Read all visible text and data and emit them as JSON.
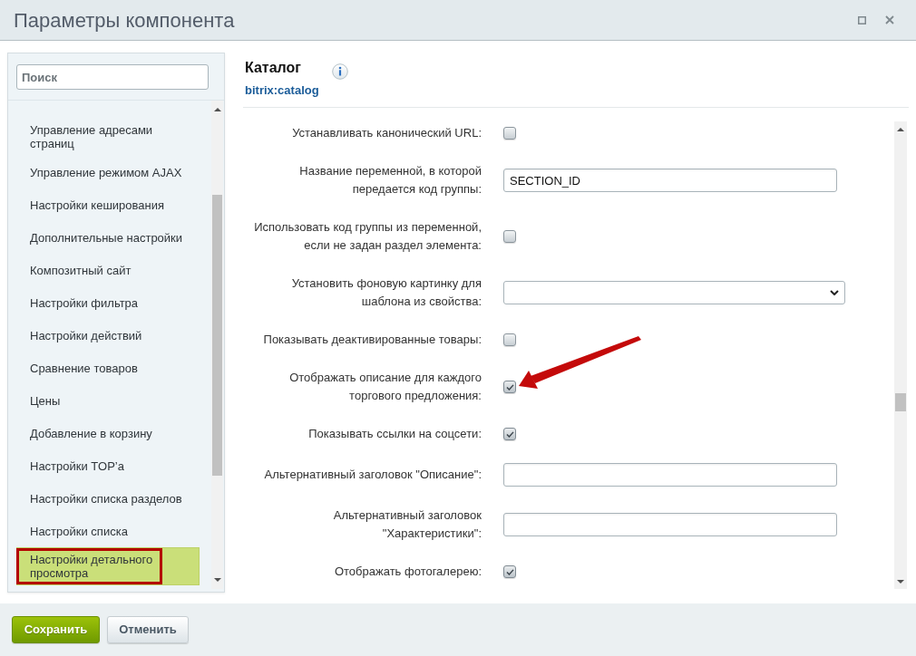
{
  "window": {
    "title": "Параметры компонента"
  },
  "sidebar": {
    "search": {
      "placeholder": "Поиск"
    },
    "items": [
      {
        "label": "Управление адресами страниц",
        "selected": false,
        "framed": false
      },
      {
        "label": "Управление режимом AJAX",
        "selected": false,
        "framed": false
      },
      {
        "label": "Настройки кеширования",
        "selected": false,
        "framed": false
      },
      {
        "label": "Дополнительные настройки",
        "selected": false,
        "framed": false
      },
      {
        "label": "Композитный сайт",
        "selected": false,
        "framed": false
      },
      {
        "label": "Настройки фильтра",
        "selected": false,
        "framed": false
      },
      {
        "label": "Настройки действий",
        "selected": false,
        "framed": false
      },
      {
        "label": "Сравнение товаров",
        "selected": false,
        "framed": false
      },
      {
        "label": "Цены",
        "selected": false,
        "framed": false
      },
      {
        "label": "Добавление в корзину",
        "selected": false,
        "framed": false
      },
      {
        "label": "Настройки TOP’а",
        "selected": false,
        "framed": false
      },
      {
        "label": "Настройки списка разделов",
        "selected": false,
        "framed": false
      },
      {
        "label": "Настройки списка",
        "selected": false,
        "framed": false
      },
      {
        "label": "Настройки детального просмотра",
        "selected": true,
        "framed": true
      }
    ]
  },
  "component": {
    "name": "Каталог",
    "code": "bitrix:catalog"
  },
  "settings": [
    {
      "kind": "checkbox",
      "label": "Устанавливать канонический URL:",
      "checked": false,
      "arrow": false
    },
    {
      "kind": "text",
      "label": "Название переменной, в которой передается код группы:",
      "value": "SECTION_ID",
      "arrow": false
    },
    {
      "kind": "checkbox",
      "label": "Использовать код группы из переменной, если не задан раздел элемента:",
      "checked": false,
      "arrow": false
    },
    {
      "kind": "select",
      "label": "Установить фоновую картинку для шаблона из свойства:",
      "arrow": false
    },
    {
      "kind": "checkbox",
      "label": "Показывать деактивированные товары:",
      "checked": false,
      "arrow": false
    },
    {
      "kind": "checkbox",
      "label": "Отображать описание для каждого торгового предложения:",
      "checked": true,
      "arrow": true
    },
    {
      "kind": "checkbox",
      "label": "Показывать ссылки на соцсети:",
      "checked": true,
      "arrow": false
    },
    {
      "kind": "text",
      "label": "Альтернативный заголовок \"Описание\":",
      "arrow": false
    },
    {
      "kind": "text",
      "label": "Альтернативный заголовок \"Характеристики\":",
      "arrow": false
    },
    {
      "kind": "checkbox",
      "label": "Отображать фотогалерею:",
      "checked": true,
      "arrow": false
    }
  ],
  "buttons": [
    {
      "kind": "primary",
      "label": "Сохранить"
    },
    {
      "kind": "secondary",
      "label": "Отменить"
    }
  ]
}
